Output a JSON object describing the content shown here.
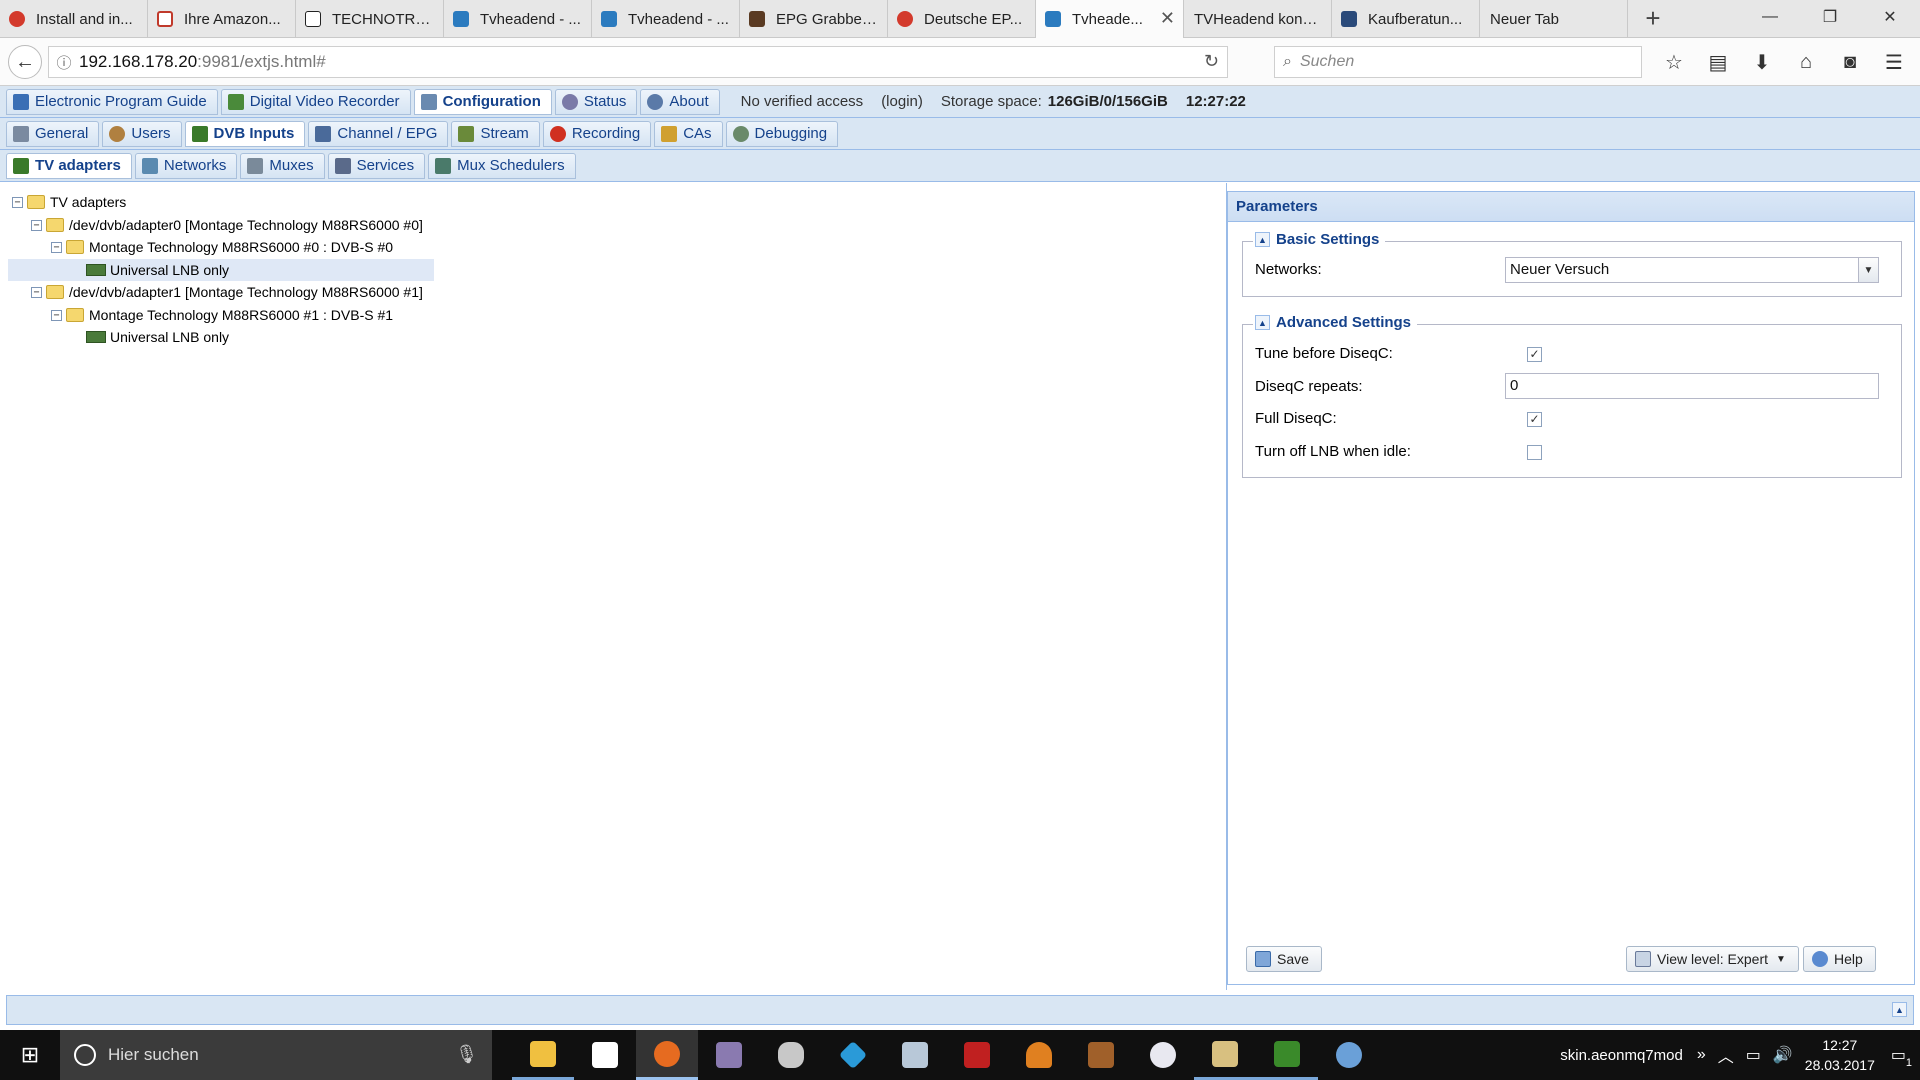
{
  "browser": {
    "tabs": [
      {
        "label": "Install and in...",
        "color": "#d33a2c"
      },
      {
        "label": "Ihre Amazon...",
        "color": "#c0392b"
      },
      {
        "label": "TECHNOTRE...",
        "color": "#222222"
      },
      {
        "label": "Tvheadend - ...",
        "color": "#2b7bbf"
      },
      {
        "label": "Tvheadend - ...",
        "color": "#2b7bbf"
      },
      {
        "label": "EPG Grabber...",
        "color": "#5a3a22"
      },
      {
        "label": "Deutsche EP...",
        "color": "#d33a2c"
      },
      {
        "label": "Tvheade...",
        "color": "#2b7bbf",
        "active": true
      },
      {
        "label": "TVHeadend konfi...",
        "color": "#e7e7e7"
      },
      {
        "label": "Kaufberatun...",
        "color": "#2a4a7a"
      },
      {
        "label": "Neuer Tab",
        "color": "#e7e7e7"
      }
    ],
    "url_host": "192.168.178.20",
    "url_rest": ":9981/extjs.html#",
    "search_placeholder": "Suchen"
  },
  "app": {
    "top_tabs": [
      {
        "label": "Electronic Program Guide",
        "icon": "epg-icon",
        "color": "#3a6fb5"
      },
      {
        "label": "Digital Video Recorder",
        "icon": "dvr-download-icon",
        "color": "#4a8a3a"
      },
      {
        "label": "Configuration",
        "icon": "wrench-icon",
        "color": "#6a8ab0",
        "active": true
      },
      {
        "label": "Status",
        "icon": "eye-icon",
        "color": "#7a7aa8"
      },
      {
        "label": "About",
        "icon": "info-icon",
        "color": "#5a7aa8"
      }
    ],
    "access_text": "No verified access",
    "login_text": "(login)",
    "storage_label": "Storage space:",
    "storage_value": "126GiB/0/156GiB",
    "time": "12:27:22",
    "config_tabs": [
      {
        "label": "General",
        "icon": "tools-icon",
        "color": "#7a8aa0"
      },
      {
        "label": "Users",
        "icon": "users-icon",
        "color": "#b08040"
      },
      {
        "label": "DVB Inputs",
        "icon": "dvb-card-icon",
        "color": "#3a7a2a",
        "active": true
      },
      {
        "label": "Channel / EPG",
        "icon": "tv-icon",
        "color": "#4a6a9a"
      },
      {
        "label": "Stream",
        "icon": "stream-icon",
        "color": "#6a8a3a"
      },
      {
        "label": "Recording",
        "icon": "rec-icon",
        "color": "#d03020"
      },
      {
        "label": "CAs",
        "icon": "key-icon",
        "color": "#d0a030"
      },
      {
        "label": "Debugging",
        "icon": "debug-icon",
        "color": "#6a8a6a"
      }
    ],
    "dvb_tabs": [
      {
        "label": "TV adapters",
        "icon": "adapter-icon",
        "color": "#3a7a2a",
        "active": true
      },
      {
        "label": "Networks",
        "icon": "antenna-icon",
        "color": "#5a8ab0"
      },
      {
        "label": "Muxes",
        "icon": "mux-icon",
        "color": "#7a8a9a"
      },
      {
        "label": "Services",
        "icon": "services-icon",
        "color": "#5a6a8a"
      },
      {
        "label": "Mux Schedulers",
        "icon": "scheduler-icon",
        "color": "#4a7a6a"
      }
    ],
    "tree": {
      "root": "TV adapters",
      "adapter0": "/dev/dvb/adapter0 [Montage Technology M88RS6000 #0]",
      "frontend0": "Montage Technology M88RS6000 #0 : DVB-S #0",
      "lnb0": "Universal LNB only",
      "adapter1": "/dev/dvb/adapter1 [Montage Technology M88RS6000 #1]",
      "frontend1": "Montage Technology M88RS6000 #1 : DVB-S #1",
      "lnb1": "Universal LNB only"
    },
    "params": {
      "title": "Parameters",
      "basic_title": "Basic Settings",
      "networks_label": "Networks:",
      "networks_value": "Neuer Versuch",
      "advanced_title": "Advanced Settings",
      "tune_label": "Tune before DiseqC:",
      "tune_checked": true,
      "repeats_label": "DiseqC repeats:",
      "repeats_value": "0",
      "full_label": "Full DiseqC:",
      "full_checked": true,
      "turnoff_label": "Turn off LNB when idle:",
      "turnoff_checked": false,
      "save": "Save",
      "view_level": "View level: Expert",
      "help": "Help"
    }
  },
  "taskbar": {
    "search_placeholder": "Hier suchen",
    "tray_text": "skin.aeonmq7mod",
    "clock_time": "12:27",
    "clock_date": "28.03.2017",
    "notification_count": "1"
  }
}
